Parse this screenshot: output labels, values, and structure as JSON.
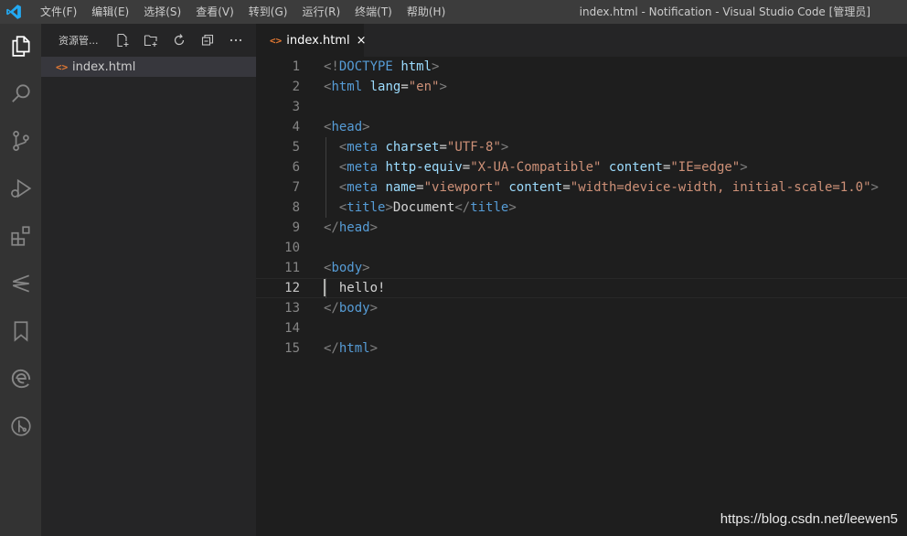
{
  "titlebar": {
    "app_icon": "vscode-logo",
    "menu": [
      "文件(F)",
      "编辑(E)",
      "选择(S)",
      "查看(V)",
      "转到(G)",
      "运行(R)",
      "终端(T)",
      "帮助(H)"
    ],
    "window_title": "index.html - Notification - Visual Studio Code [管理员]"
  },
  "activitybar": {
    "icons": [
      "files-icon",
      "search-icon",
      "source-control-icon",
      "run-debug-icon",
      "extensions-icon",
      "remote-icon",
      "bookmark-icon",
      "edge-icon",
      "git-graph-icon"
    ]
  },
  "sidebar": {
    "title": "资源管...",
    "tools": [
      "new-file-icon",
      "new-folder-icon",
      "refresh-icon",
      "collapse-all-icon",
      "more-icon"
    ],
    "files": [
      {
        "icon": "<>",
        "name": "index.html"
      }
    ]
  },
  "tabs": [
    {
      "icon": "<>",
      "label": "index.html",
      "close": "×",
      "active": true
    }
  ],
  "editor": {
    "active_line": 12,
    "lines": [
      [
        {
          "t": "<!",
          "c": "punc"
        },
        {
          "t": "DOCTYPE",
          "c": "tag"
        },
        {
          "t": " ",
          "c": "text"
        },
        {
          "t": "html",
          "c": "attr"
        },
        {
          "t": ">",
          "c": "punc"
        }
      ],
      [
        {
          "t": "<",
          "c": "punc"
        },
        {
          "t": "html",
          "c": "tag"
        },
        {
          "t": " ",
          "c": "text"
        },
        {
          "t": "lang",
          "c": "attr"
        },
        {
          "t": "=",
          "c": "text"
        },
        {
          "t": "\"en\"",
          "c": "str"
        },
        {
          "t": ">",
          "c": "punc"
        }
      ],
      [],
      [
        {
          "t": "<",
          "c": "punc"
        },
        {
          "t": "head",
          "c": "tag"
        },
        {
          "t": ">",
          "c": "punc"
        }
      ],
      [
        {
          "t": "  ",
          "c": "text"
        },
        {
          "t": "<",
          "c": "punc"
        },
        {
          "t": "meta",
          "c": "tag"
        },
        {
          "t": " ",
          "c": "text"
        },
        {
          "t": "charset",
          "c": "attr"
        },
        {
          "t": "=",
          "c": "text"
        },
        {
          "t": "\"UTF-8\"",
          "c": "str"
        },
        {
          "t": ">",
          "c": "punc"
        }
      ],
      [
        {
          "t": "  ",
          "c": "text"
        },
        {
          "t": "<",
          "c": "punc"
        },
        {
          "t": "meta",
          "c": "tag"
        },
        {
          "t": " ",
          "c": "text"
        },
        {
          "t": "http-equiv",
          "c": "attr"
        },
        {
          "t": "=",
          "c": "text"
        },
        {
          "t": "\"X-UA-Compatible\"",
          "c": "str"
        },
        {
          "t": " ",
          "c": "text"
        },
        {
          "t": "content",
          "c": "attr"
        },
        {
          "t": "=",
          "c": "text"
        },
        {
          "t": "\"IE=edge\"",
          "c": "str"
        },
        {
          "t": ">",
          "c": "punc"
        }
      ],
      [
        {
          "t": "  ",
          "c": "text"
        },
        {
          "t": "<",
          "c": "punc"
        },
        {
          "t": "meta",
          "c": "tag"
        },
        {
          "t": " ",
          "c": "text"
        },
        {
          "t": "name",
          "c": "attr"
        },
        {
          "t": "=",
          "c": "text"
        },
        {
          "t": "\"viewport\"",
          "c": "str"
        },
        {
          "t": " ",
          "c": "text"
        },
        {
          "t": "content",
          "c": "attr"
        },
        {
          "t": "=",
          "c": "text"
        },
        {
          "t": "\"width=device-width, initial-scale=1.0\"",
          "c": "str"
        },
        {
          "t": ">",
          "c": "punc"
        }
      ],
      [
        {
          "t": "  ",
          "c": "text"
        },
        {
          "t": "<",
          "c": "punc"
        },
        {
          "t": "title",
          "c": "tag"
        },
        {
          "t": ">",
          "c": "punc"
        },
        {
          "t": "Document",
          "c": "text"
        },
        {
          "t": "</",
          "c": "punc"
        },
        {
          "t": "title",
          "c": "tag"
        },
        {
          "t": ">",
          "c": "punc"
        }
      ],
      [
        {
          "t": "</",
          "c": "punc"
        },
        {
          "t": "head",
          "c": "tag"
        },
        {
          "t": ">",
          "c": "punc"
        }
      ],
      [],
      [
        {
          "t": "<",
          "c": "punc"
        },
        {
          "t": "body",
          "c": "tag"
        },
        {
          "t": ">",
          "c": "punc"
        }
      ],
      [
        {
          "t": "  ",
          "c": "text"
        },
        {
          "t": "hello!",
          "c": "text"
        }
      ],
      [
        {
          "t": "</",
          "c": "punc"
        },
        {
          "t": "body",
          "c": "tag"
        },
        {
          "t": ">",
          "c": "punc"
        }
      ],
      [],
      [
        {
          "t": "</",
          "c": "punc"
        },
        {
          "t": "html",
          "c": "tag"
        },
        {
          "t": ">",
          "c": "punc"
        }
      ]
    ]
  },
  "watermark": "https://blog.csdn.net/leewen5",
  "colors": {
    "titlebar": "#3c3c3c",
    "activitybar": "#333333",
    "sidebar": "#252526",
    "editor": "#1e1e1e",
    "tag": "#569cd6",
    "attr": "#9cdcfe",
    "string": "#ce9178",
    "punctuation": "#808080",
    "html_file_icon": "#e37933",
    "vscode_blue": "#23a9f2"
  }
}
